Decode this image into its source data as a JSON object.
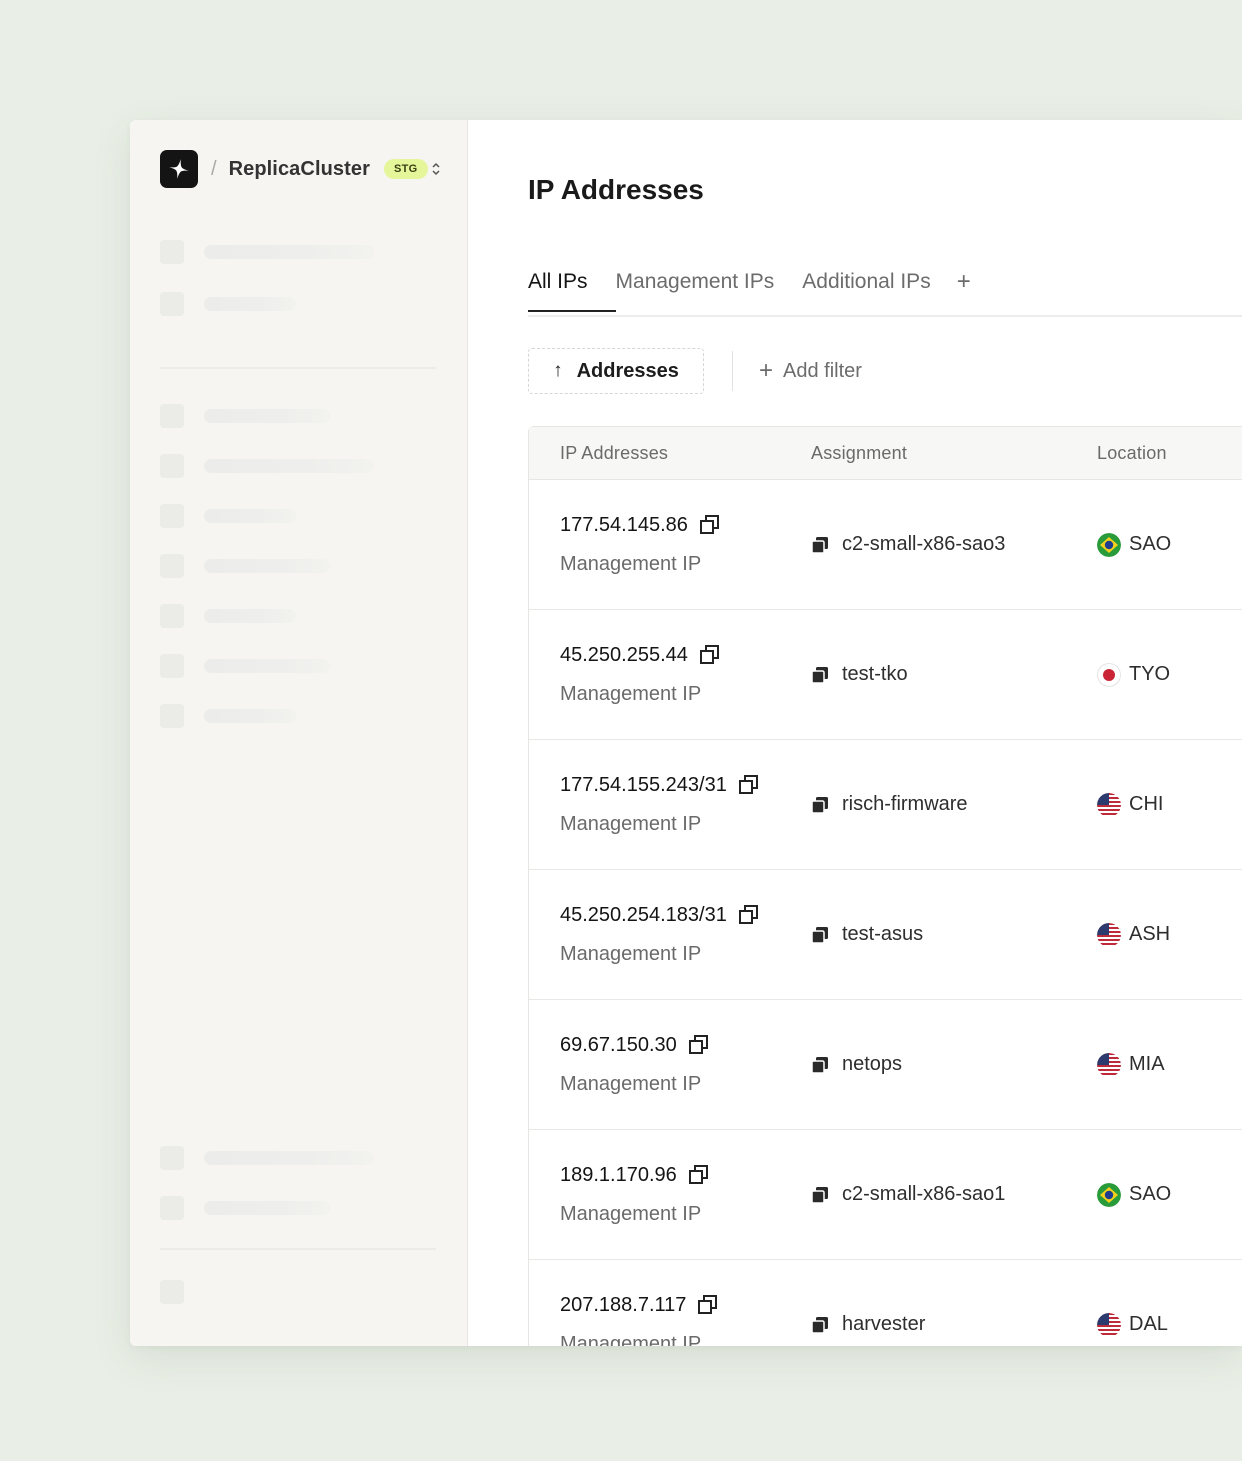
{
  "sidebar": {
    "project_name": "ReplicaCluster",
    "environment": "STG"
  },
  "page": {
    "title": "IP Addresses"
  },
  "tabs": [
    {
      "label": "All IPs",
      "active": true
    },
    {
      "label": "Management IPs",
      "active": false
    },
    {
      "label": "Additional IPs",
      "active": false
    }
  ],
  "toolbar": {
    "sort_label": "Addresses",
    "filter_label": "Add filter"
  },
  "table": {
    "columns": [
      "IP Addresses",
      "Assignment",
      "Location"
    ],
    "rows": [
      {
        "ip": "177.54.145.86",
        "type": "Management IP",
        "assignment": "c2-small-x86-sao3",
        "location": "SAO",
        "flag": "brazil"
      },
      {
        "ip": "45.250.255.44",
        "type": "Management IP",
        "assignment": "test-tko",
        "location": "TYO",
        "flag": "japan"
      },
      {
        "ip": "177.54.155.243/31",
        "type": "Management IP",
        "assignment": "risch-firmware",
        "location": "CHI",
        "flag": "usa"
      },
      {
        "ip": "45.250.254.183/31",
        "type": "Management IP",
        "assignment": "test-asus",
        "location": "ASH",
        "flag": "usa"
      },
      {
        "ip": "69.67.150.30",
        "type": "Management IP",
        "assignment": "netops",
        "location": "MIA",
        "flag": "usa"
      },
      {
        "ip": "189.1.170.96",
        "type": "Management IP",
        "assignment": "c2-small-x86-sao1",
        "location": "SAO",
        "flag": "brazil"
      },
      {
        "ip": "207.188.7.117",
        "type": "Management IP",
        "assignment": "harvester",
        "location": "DAL",
        "flag": "usa"
      }
    ]
  }
}
